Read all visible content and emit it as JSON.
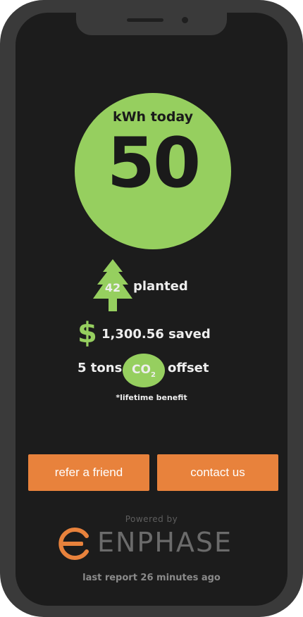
{
  "energy": {
    "label": "kWh today",
    "value": "50"
  },
  "trees": {
    "count": "42",
    "label": "planted"
  },
  "savings": {
    "symbol": "$",
    "label": "1,300.56 saved"
  },
  "carbon": {
    "amount": "5 tons",
    "co2": "CO",
    "co2_sub": "2",
    "label": "offset"
  },
  "footnote": "*lifetime benefit",
  "actions": {
    "refer": "refer a friend",
    "contact": "contact us"
  },
  "branding": {
    "powered_by": "Powered by",
    "logo_text": "ENPHASE"
  },
  "status": {
    "last_report": "last report 26 minutes ago"
  },
  "colors": {
    "accent_green": "#96cf5f",
    "button_orange": "#e8823c",
    "background": "#1c1c1c"
  }
}
